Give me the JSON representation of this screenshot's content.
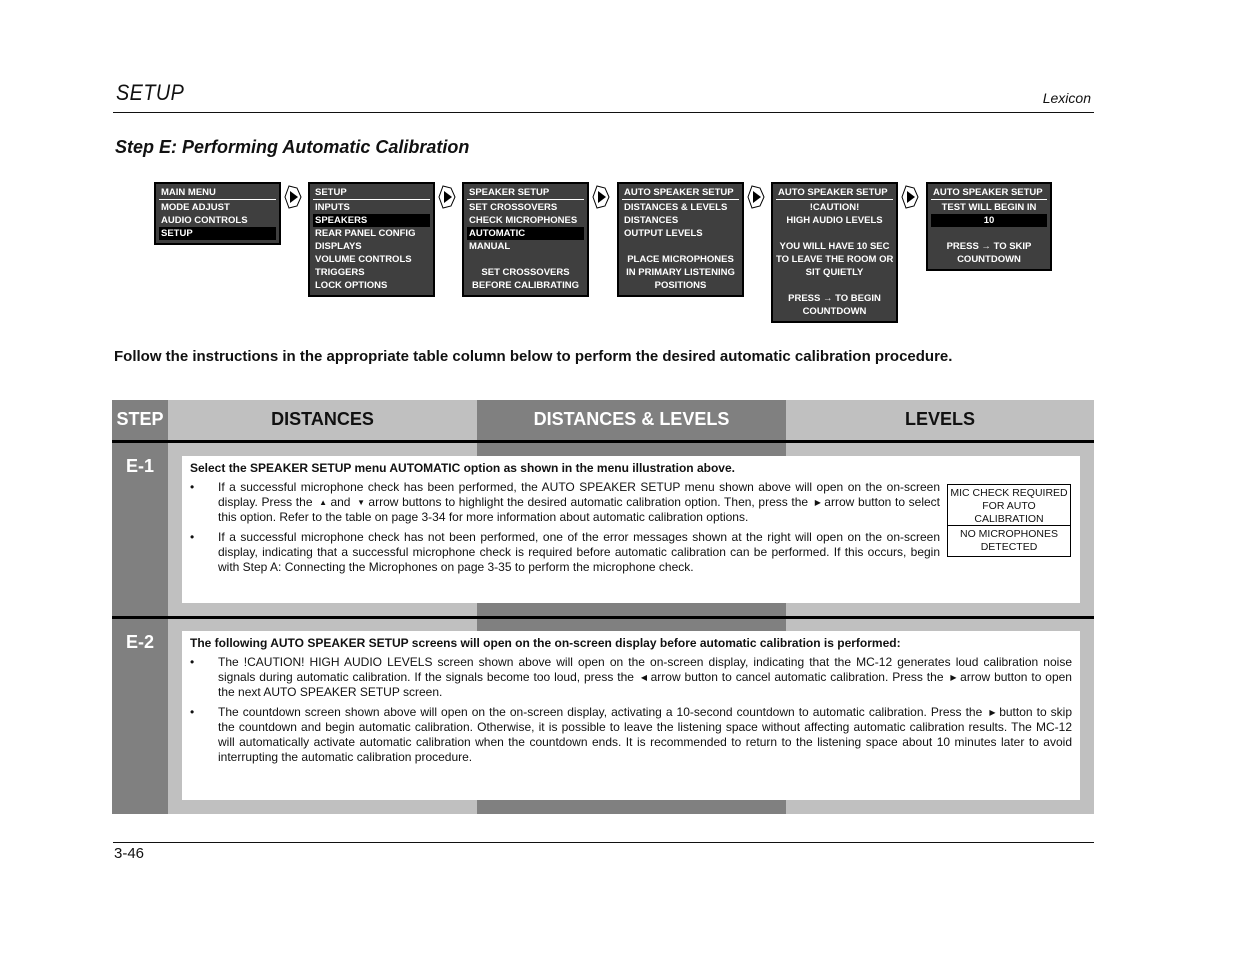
{
  "header": {
    "section": "SETUP",
    "brand": "Lexicon"
  },
  "step_title": "Step E: Performing Automatic Calibration",
  "menus": [
    {
      "title": "MAIN MENU",
      "lines": [
        {
          "text": "MODE ADJUST"
        },
        {
          "text": "AUDIO CONTROLS"
        },
        {
          "text": "SETUP",
          "highlight": true
        }
      ]
    },
    {
      "title": "SETUP",
      "lines": [
        {
          "text": "INPUTS"
        },
        {
          "text": "SPEAKERS",
          "highlight": true
        },
        {
          "text": "REAR PANEL CONFIG"
        },
        {
          "text": "DISPLAYS"
        },
        {
          "text": "VOLUME CONTROLS"
        },
        {
          "text": "TRIGGERS"
        },
        {
          "text": "LOCK OPTIONS"
        }
      ]
    },
    {
      "title": "SPEAKER SETUP",
      "lines": [
        {
          "text": "SET CROSSOVERS"
        },
        {
          "text": "CHECK MICROPHONES"
        },
        {
          "text": "AUTOMATIC",
          "highlight": true
        },
        {
          "text": "MANUAL"
        },
        {
          "text": ""
        },
        {
          "text": "SET CROSSOVERS",
          "center": true
        },
        {
          "text": "BEFORE CALIBRATING",
          "center": true
        }
      ]
    },
    {
      "title": "AUTO SPEAKER SETUP",
      "lines": [
        {
          "text": "DISTANCES & LEVELS"
        },
        {
          "text": "DISTANCES"
        },
        {
          "text": "OUTPUT LEVELS"
        },
        {
          "text": ""
        },
        {
          "text": "PLACE MICROPHONES",
          "center": true
        },
        {
          "text": "IN PRIMARY LISTENING",
          "center": true
        },
        {
          "text": "POSITIONS",
          "center": true
        }
      ]
    },
    {
      "title": "AUTO SPEAKER SETUP",
      "lines": [
        {
          "text": "!CAUTION!",
          "center": true
        },
        {
          "text": "HIGH AUDIO LEVELS",
          "center": true
        },
        {
          "text": ""
        },
        {
          "text": "YOU WILL HAVE 10 SEC",
          "center": true
        },
        {
          "text": "TO LEAVE THE ROOM OR",
          "center": true
        },
        {
          "text": "SIT QUIETLY",
          "center": true
        },
        {
          "text": ""
        },
        {
          "text": "PRESS → TO BEGIN",
          "center": true
        },
        {
          "text": "COUNTDOWN",
          "center": true
        }
      ]
    },
    {
      "title": "AUTO SPEAKER SETUP",
      "lines": [
        {
          "text": "TEST WILL BEGIN IN",
          "center": true
        },
        {
          "text": "10",
          "center": true,
          "highlight": true
        },
        {
          "text": ""
        },
        {
          "text": "PRESS → TO SKIP",
          "center": true
        },
        {
          "text": "COUNTDOWN",
          "center": true
        }
      ]
    }
  ],
  "instruction": "Follow the instructions in the appropriate table column below to perform the desired automatic calibration procedure.",
  "table": {
    "headers": {
      "step": "STEP",
      "distances": "DISTANCES",
      "distances_levels": "DISTANCES & LEVELS",
      "levels": "LEVELS"
    },
    "colors": {
      "dark": "#808080",
      "light": "#c0c0c0"
    },
    "rows": [
      {
        "step": "E-1",
        "lead": "Select the SPEAKER SETUP menu AUTOMATIC option as shown in the menu illustration above.",
        "b1": {
          "p1": "If a successful microphone check has been performed, the AUTO SPEAKER SETUP menu shown above will open on the on-screen display. Press the",
          "up": "▲",
          "p2": "and",
          "down": "▼",
          "p3": "arrow buttons to highlight the desired automatic calibration option. Then, press the",
          "right": "▶",
          "p4": "arrow button to select this option. Refer to the table on page 3-34 for more information about automatic calibration options."
        },
        "b2": "If a successful microphone check has not been performed, one of the error messages shown at the right will open on the on-screen display, indicating that a successful microphone check is required before automatic calibration can be performed. If this occurs, begin with Step A: Connecting the Microphones on page 3-35 to perform the microphone check.",
        "errors": [
          {
            "l1": "MIC CHECK REQUIRED",
            "l2": "FOR AUTO CALIBRATION"
          },
          {
            "l1": "NO MICROPHONES",
            "l2": "DETECTED"
          }
        ]
      },
      {
        "step": "E-2",
        "lead": "The following AUTO SPEAKER SETUP screens will open on the on-screen display before automatic calibration is performed:",
        "b1": {
          "p1": "The !CAUTION! HIGH AUDIO LEVELS screen shown above will open on the on-screen display, indicating that the MC-12 generates loud calibration noise signals during automatic calibration. If the signals become too loud, press the",
          "left": "◀",
          "p2": "arrow button to cancel automatic calibration. Press the",
          "right": "▶",
          "p3": "arrow button to open the next AUTO SPEAKER SETUP screen."
        },
        "b2": {
          "p1": "The countdown screen shown above will open on the on-screen display, activating a 10-second countdown to automatic calibration. Press the",
          "right": "▶",
          "p2": "button to skip the countdown and begin automatic calibration. Otherwise, it is possible to leave the listening space without affecting automatic calibration results. The MC-12 will automatically activate automatic calibration when the countdown ends. It is recommended to return to the listening space about 10 minutes later to avoid interrupting the automatic calibration procedure."
        }
      }
    ]
  },
  "bullet": "•",
  "footer": {
    "page": "3-46"
  }
}
